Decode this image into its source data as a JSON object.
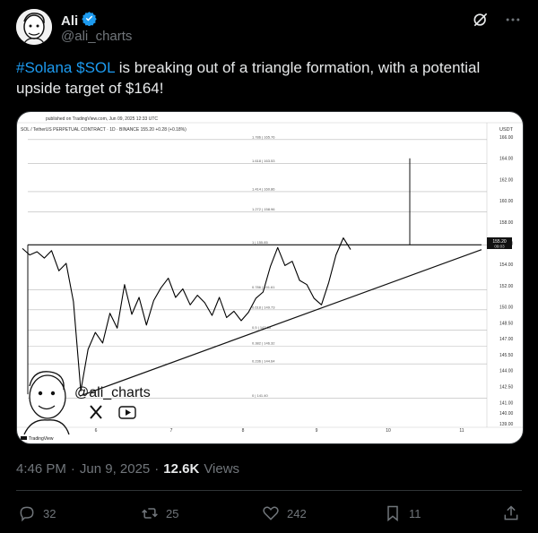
{
  "author": {
    "name": "Ali",
    "handle": "@ali_charts",
    "verified": true
  },
  "tweet": {
    "hashtag": "#Solana",
    "cashtag": "$SOL",
    "text": " is breaking out of a triangle formation, with a potential upside target of $164!"
  },
  "chart": {
    "published": "published on TradingView.com, Jun 09, 2025 12:33 UTC",
    "symbol": "SOL / TetherUS PERPETUAL CONTRACT · 1D · BINANCE  155.20  +0.28 (+0.18%)",
    "currency": "USDT",
    "price_label": "155.20",
    "price_sub": "09:03",
    "watermark_handle": "@ali_charts",
    "tv_brand": "TradingView",
    "y_ticks": [
      "166.00",
      "164.00",
      "162.00",
      "160.00",
      "158.00",
      "156.00",
      "154.00",
      "152.00",
      "150.00",
      "148.50",
      "147.00",
      "145.50",
      "144.00",
      "142.50",
      "141.00",
      "140.00",
      "139.00"
    ],
    "x_ticks": [
      "6",
      "7",
      "8",
      "9",
      "10",
      "11"
    ],
    "fib_levels": [
      "1.786 | 165.76",
      "1.618 | 163.53",
      "1.414 | 160.86",
      "1.272 | 158.96",
      "1 | 155.85",
      "0.786 | 151.61",
      "0.618 | 149.73",
      "0.5 | 147.80",
      "0.382 | 146.32",
      "0.236 | 144.64",
      "0 | 141.40"
    ]
  },
  "chart_data": {
    "type": "line",
    "title": "SOL / TetherUS PERPETUAL CONTRACT · 1D · BINANCE",
    "ylabel": "USDT",
    "ylim": [
      139,
      166
    ],
    "x": [
      "6",
      "7",
      "8",
      "9",
      "10",
      "11"
    ],
    "series": [
      {
        "values": [
          155.5,
          154.9,
          155.2,
          154.6,
          155.3,
          153.4,
          154.1,
          150.5,
          142.1,
          146.0,
          147.6,
          146.6,
          149.4,
          148.0,
          152.1,
          149.3,
          150.9,
          148.3,
          150.6,
          151.8,
          152.7,
          150.9,
          151.7,
          150.2,
          151.1,
          150.4,
          149.2,
          150.9,
          149.0,
          149.6,
          148.7,
          149.5,
          150.8,
          151.4,
          153.8,
          155.6,
          153.9,
          154.3,
          152.5,
          152.1,
          150.8,
          150.2,
          152.3,
          154.9,
          156.5,
          155.4
        ]
      }
    ],
    "trendline_support": [
      141.6,
      155.4
    ],
    "resistance": 155.85,
    "target": 164.0
  },
  "stats": {
    "time": "4:46 PM",
    "date": "Jun 9, 2025",
    "views_count": "12.6K",
    "views_label": "Views",
    "replies": "32",
    "reposts": "25",
    "likes": "242",
    "bookmarks": "11"
  }
}
